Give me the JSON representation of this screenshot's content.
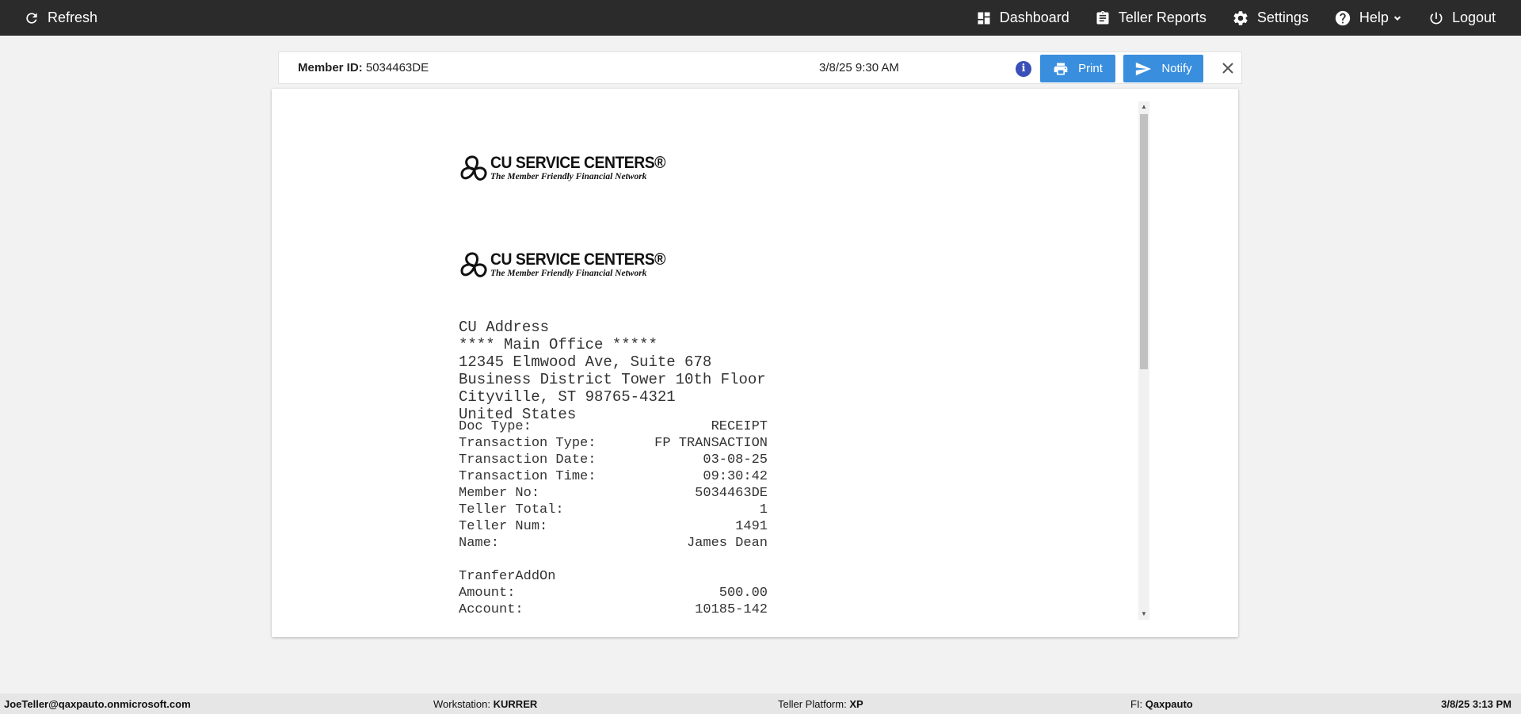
{
  "topbar": {
    "refresh_label": "Refresh",
    "nav": {
      "dashboard": "Dashboard",
      "teller_reports": "Teller Reports",
      "settings": "Settings",
      "help": "Help",
      "logout": "Logout"
    }
  },
  "member_bar": {
    "member_id_label": "Member ID:",
    "member_id": "5034463DE",
    "datetime": "3/8/25 9:30 AM",
    "info_icon": "i",
    "print_label": "Print",
    "notify_label": "Notify"
  },
  "document": {
    "logo": {
      "name": "CU SERVICE CENTERS®",
      "tagline": "The Member Friendly Financial Network"
    },
    "address_lines": [
      "CU Address",
      "**** Main Office *****",
      "12345 Elmwood Ave, Suite 678",
      "Business District Tower 10th Floor",
      "Cityville, ST 98765-4321",
      "United States"
    ],
    "fields": [
      {
        "label": "Doc Type:",
        "value": "RECEIPT"
      },
      {
        "label": "Transaction Type:",
        "value": "FP TRANSACTION"
      },
      {
        "label": "Transaction Date:",
        "value": "03-08-25"
      },
      {
        "label": "Transaction Time:",
        "value": "09:30:42"
      },
      {
        "label": "Member No:",
        "value": "5034463DE"
      },
      {
        "label": "Teller Total:",
        "value": "1"
      },
      {
        "label": "Teller Num:",
        "value": "1491"
      },
      {
        "label": "Name:",
        "value": "James Dean"
      }
    ],
    "section_title": "TranferAddOn",
    "section_fields": [
      {
        "label": "Amount:",
        "value": "500.00"
      },
      {
        "label": "Account:",
        "value": "10185-142"
      }
    ]
  },
  "statusbar": {
    "user": "JoeTeller@qaxpauto.onmicrosoft.com",
    "workstation_label": "Workstation:",
    "workstation": "KURRER",
    "platform_label": "Teller Platform:",
    "platform": "XP",
    "fi_label": "FI:",
    "fi": "Qaxpauto",
    "datetime": "3/8/25 3:13 PM"
  },
  "colors": {
    "topbar": "#2b2b2b",
    "button": "#3a8ede",
    "info": "#3a4fb8"
  },
  "icons": [
    "refresh-icon",
    "dashboard-icon",
    "clipboard-icon",
    "gear-icon",
    "help-icon",
    "chevron-down-icon",
    "power-icon",
    "info-icon",
    "printer-icon",
    "send-icon",
    "close-icon"
  ]
}
